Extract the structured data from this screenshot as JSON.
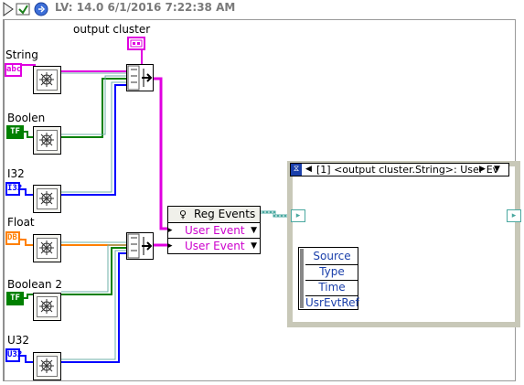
{
  "window": {
    "title": "LV: 14.0 6/1/2016 7:22:38 AM"
  },
  "output_cluster": {
    "label": "output cluster"
  },
  "controls": [
    {
      "label": "String",
      "terminal_text": "abc",
      "color": "#e000e0"
    },
    {
      "label": "Boolen",
      "terminal_text": "TF",
      "color": "#008000"
    },
    {
      "label": "I32",
      "terminal_text": "I32",
      "color": "#0000ff"
    },
    {
      "label": "Float",
      "terminal_text": "DBL",
      "color": "#ff8000"
    },
    {
      "label": "Boolean 2",
      "terminal_text": "TF",
      "color": "#008000"
    },
    {
      "label": "U32",
      "terminal_text": "U32",
      "color": "#0000ff"
    }
  ],
  "reg_events": {
    "title": "Reg Events",
    "rows": [
      "User Event",
      "User Event"
    ]
  },
  "event_structure": {
    "case_label": "[1] <output cluster.String>: User Ev",
    "event_data": [
      "Source",
      "Type",
      "Time",
      "UsrEvtRef"
    ]
  },
  "colors": {
    "string_wire": "#e000e0",
    "bool_wire": "#008000",
    "int_wire": "#0000ff",
    "float_wire": "#ff8000",
    "cluster_wire": "#4aa8a0",
    "user_event_wire": "#cc00cc",
    "event_data_text": "#1a3faa"
  }
}
